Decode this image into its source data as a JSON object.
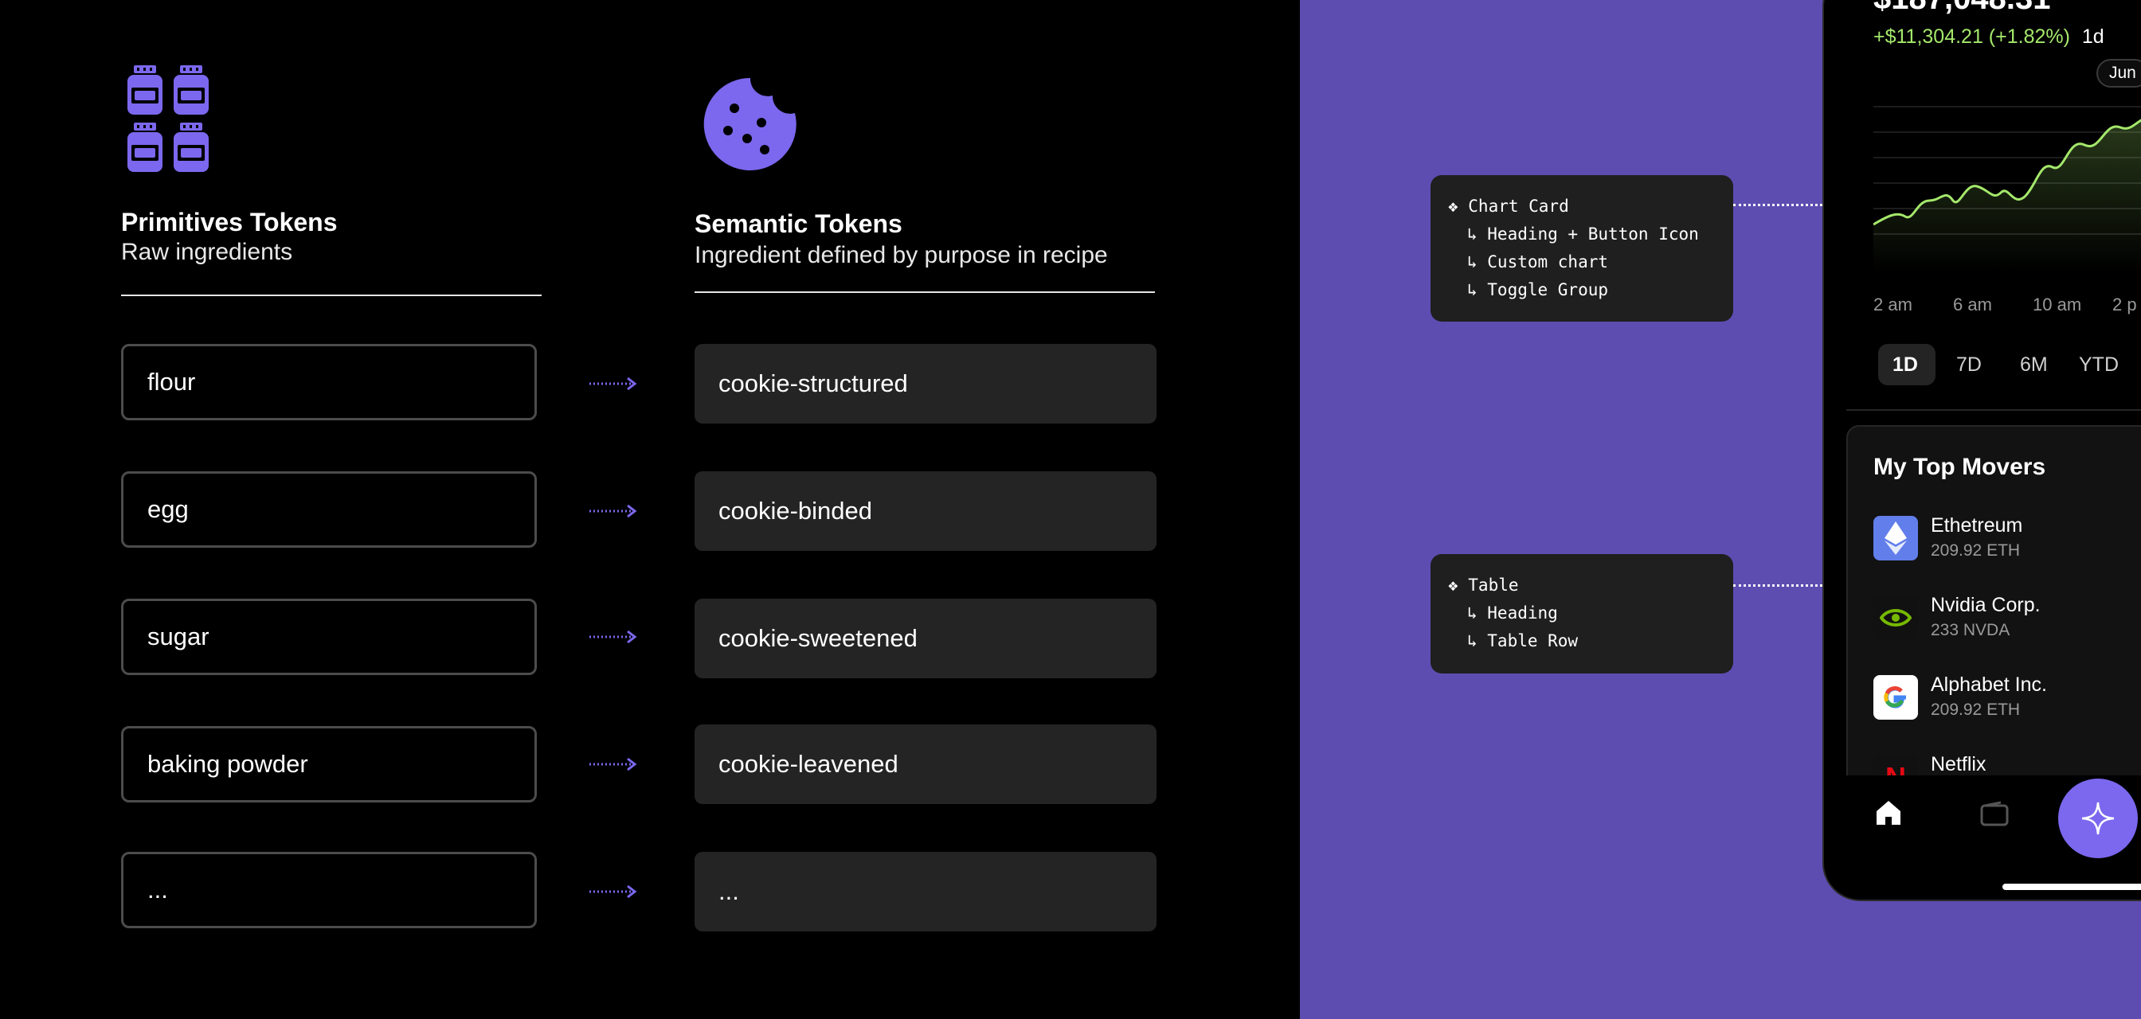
{
  "left": {
    "primitives": {
      "title": "Primitives  Tokens",
      "subtitle": "Raw ingredients",
      "icon": "jars-icon"
    },
    "semantic": {
      "title": "Semantic Tokens",
      "subtitle": "Ingredient defined by purpose in recipe",
      "icon": "cookie-icon"
    },
    "rows": [
      {
        "primitive": "flour",
        "semantic": "cookie-structured"
      },
      {
        "primitive": "egg",
        "semantic": "cookie-binded"
      },
      {
        "primitive": "sugar",
        "semantic": "cookie-sweetened"
      },
      {
        "primitive": "baking powder",
        "semantic": "cookie-leavened"
      },
      {
        "primitive": "...",
        "semantic": "..."
      }
    ]
  },
  "callouts": {
    "chart_card": {
      "title": "❖ Chart Card",
      "items": [
        "↳ Heading + Button Icon",
        "↳ Custom chart",
        "↳ Toggle Group"
      ]
    },
    "table": {
      "title": "❖ Table",
      "items": [
        "↳ Heading",
        "↳ Table Row"
      ]
    }
  },
  "phone": {
    "balance": "$187,048.31",
    "change": "+$11,304.21 (+1.82%)",
    "change_period": "1d",
    "chart_tooltip": "Jun",
    "time_ticks": [
      "2 am",
      "6 am",
      "10 am",
      "2 p"
    ],
    "toggle": [
      "1D",
      "7D",
      "6M",
      "YTD"
    ],
    "toggle_selected": "1D",
    "movers_title": "My Top Movers",
    "movers": [
      {
        "name": "Ethetreum",
        "amount": "209.92 ETH",
        "icon": "ethereum-icon"
      },
      {
        "name": "Nvidia Corp.",
        "amount": "233 NVDA",
        "icon": "nvidia-icon"
      },
      {
        "name": "Alphabet Inc.",
        "amount": "209.92 ETH",
        "icon": "google-icon"
      },
      {
        "name": "Netflix",
        "amount": "",
        "icon": "netflix-icon"
      }
    ],
    "nav": [
      "home-icon",
      "wallet-icon",
      "sparkle-icon"
    ]
  },
  "colors": {
    "accent_purple": "#7b68ee",
    "panel_purple": "#5d4db1",
    "positive_green": "#a4e86b"
  }
}
